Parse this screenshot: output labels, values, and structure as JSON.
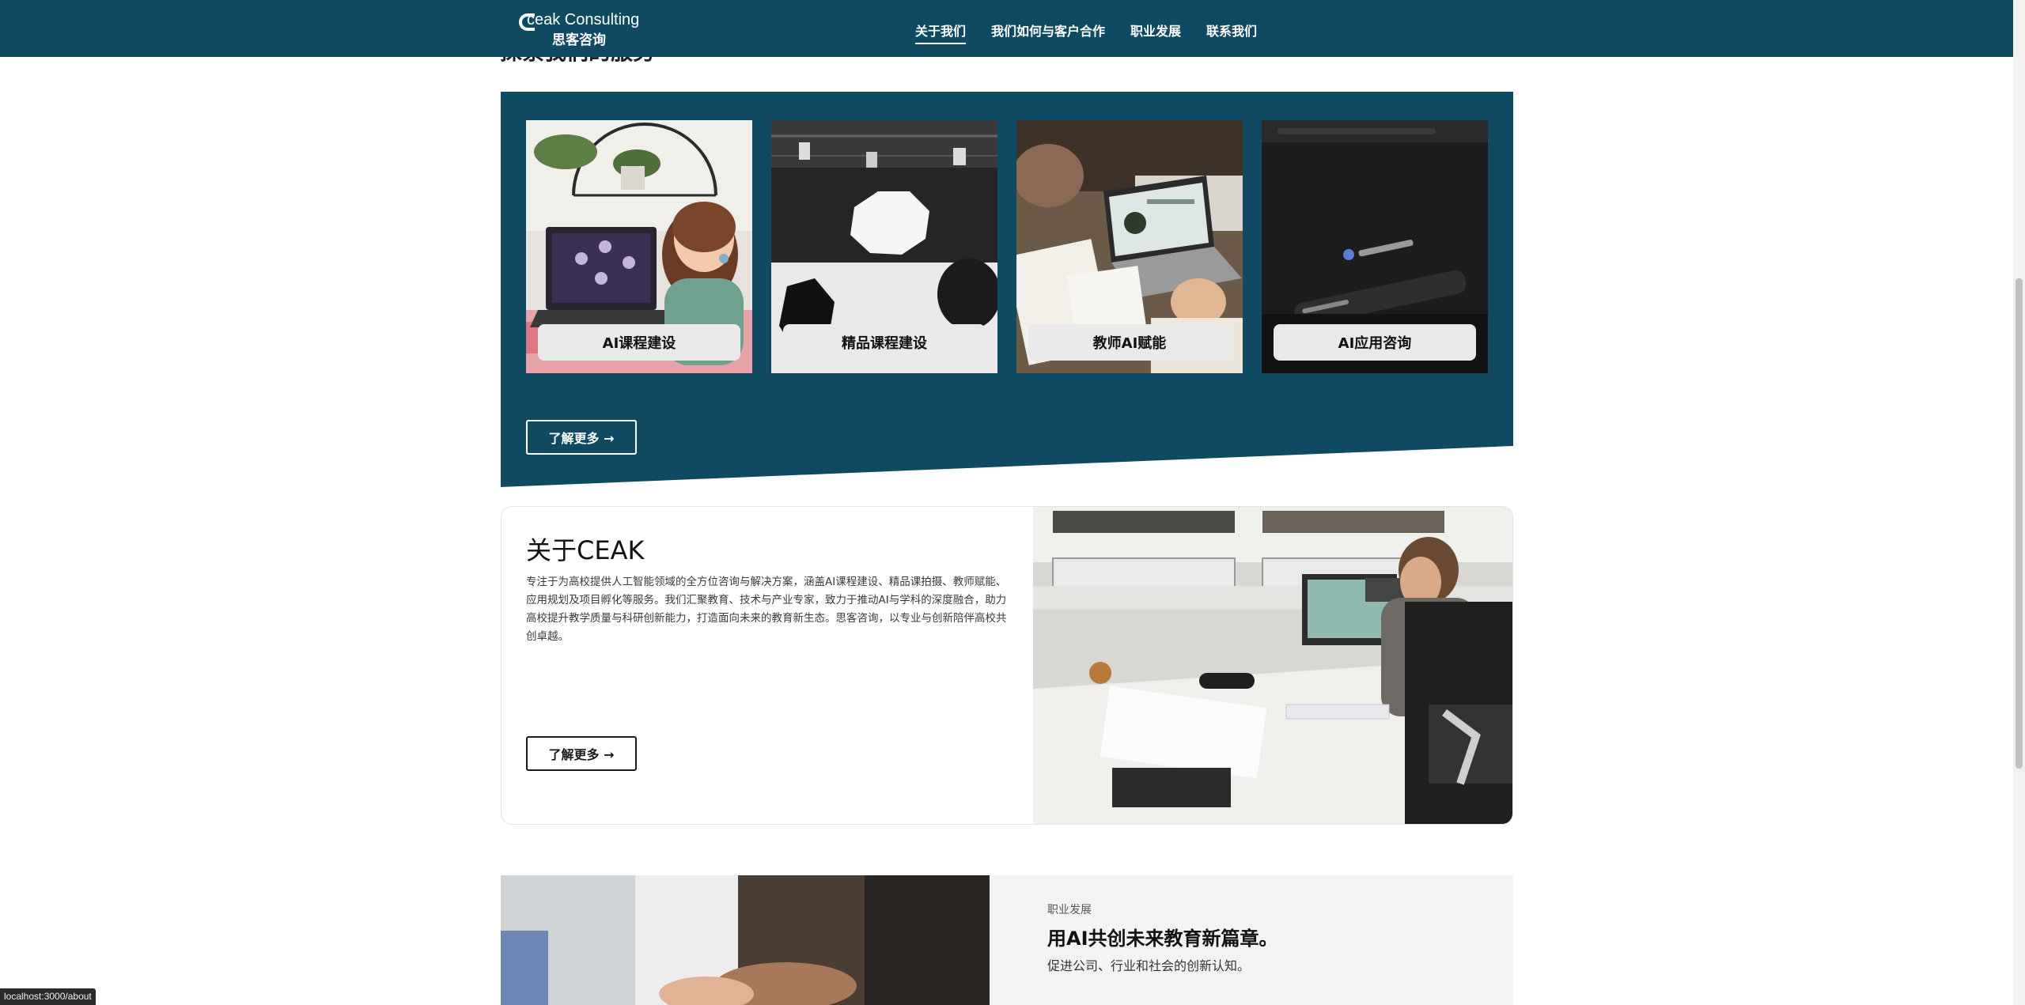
{
  "header": {
    "logo_en": "ceak Consulting",
    "logo_cn": "思客咨询",
    "nav": [
      {
        "label": "关于我们",
        "active": true
      },
      {
        "label": "我们如何与客户合作",
        "active": false
      },
      {
        "label": "职业发展",
        "active": false
      },
      {
        "label": "联系我们",
        "active": false
      }
    ]
  },
  "services": {
    "heading_partial": "探索我们的服务",
    "cards": [
      {
        "label": "AI课程建设"
      },
      {
        "label": "精品课程建设"
      },
      {
        "label": "教师AI赋能"
      },
      {
        "label": "AI应用咨询"
      }
    ],
    "more_button": "了解更多 →",
    "accent_color": "#0f4a62"
  },
  "about": {
    "title": "关于CEAK",
    "body": "专注于为高校提供人工智能领域的全方位咨询与解决方案，涵盖AI课程建设、精品课拍摄、教师赋能、应用规划及项目孵化等服务。我们汇聚教育、技术与产业专家，致力于推动AI与学科的深度融合，助力高校提升教学质量与科研创新能力，打造面向未来的教育新生态。思客咨询，以专业与创新陪伴高校共创卓越。",
    "more_button": "了解更多 →"
  },
  "career": {
    "kicker": "职业发展",
    "title": "用AI共创未来教育新篇章。",
    "subtitle": "促进公司、行业和社会的创新认知。"
  },
  "browser": {
    "status_url": "localhost:3000/about"
  }
}
